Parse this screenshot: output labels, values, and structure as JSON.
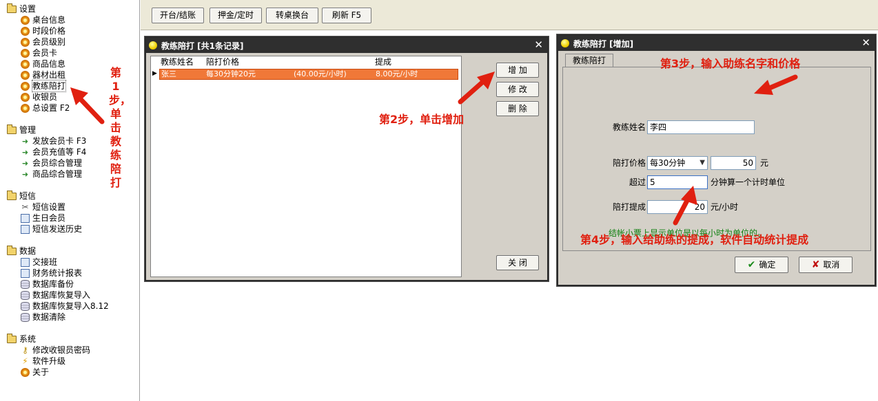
{
  "sidebar": {
    "groups": [
      {
        "label": "设置",
        "items": [
          "桌台信息",
          "时段价格",
          "会员级别",
          "会员卡",
          "商品信息",
          "器材出租",
          "教练陪打",
          "收银员",
          "总设置 F2"
        ]
      },
      {
        "label": "管理",
        "items": [
          "发放会员卡 F3",
          "会员充值等 F4",
          "会员综合管理",
          "商品综合管理"
        ]
      },
      {
        "label": "短信",
        "items": [
          "短信设置",
          "生日会员",
          "短信发送历史"
        ]
      },
      {
        "label": "数据",
        "items": [
          "交接班",
          "财务统计报表",
          "数据库备份",
          "数据库恢复导入",
          "数据库恢复导入8.12",
          "数据清除"
        ]
      },
      {
        "label": "系统",
        "items": [
          "修改收银员密码",
          "软件升级",
          "关于"
        ]
      }
    ]
  },
  "toolbar": {
    "buttons": [
      "开台/结账",
      "押金/定时",
      "转桌换台",
      "刷新 F5"
    ]
  },
  "list_dialog": {
    "title": "教练陪打 [共1条记录]",
    "columns": [
      "教练姓名",
      "陪打价格",
      "提成"
    ],
    "rows": [
      {
        "name": "张三",
        "price": "每30分钟20元",
        "rate": "(40.00元/小时)",
        "commission": "8.00元/小时"
      }
    ],
    "buttons": {
      "add": "增 加",
      "edit": "修 改",
      "delete": "删 除",
      "close": "关 闭"
    }
  },
  "add_dialog": {
    "title": "教练陪打 [增加]",
    "tab": "教练陪打",
    "fields": {
      "name_label": "教练姓名",
      "name_value": "李四",
      "price_label": "陪打价格",
      "price_period": "每30分钟",
      "price_value": "50",
      "price_unit": "元",
      "over_label": "超过",
      "over_value": "5",
      "over_suffix": "分钟算一个计时单位",
      "commission_label": "陪打提成",
      "commission_value": "20",
      "commission_unit": "元/小时"
    },
    "hint": "结帐小票上显示单位是以每小时为单位的。",
    "ok": "确定",
    "cancel": "取消"
  },
  "annotations": {
    "step1": "第1步，单击教练陪打",
    "step2": "第2步，单击增加",
    "step3": "第3步，输入助练名字和价格",
    "step4": "第4步，输入给助练的提成，软件自动统计提成"
  },
  "colors": {
    "annotation": "#e02010",
    "selected_row": "#f07838",
    "hint": "#108010"
  }
}
